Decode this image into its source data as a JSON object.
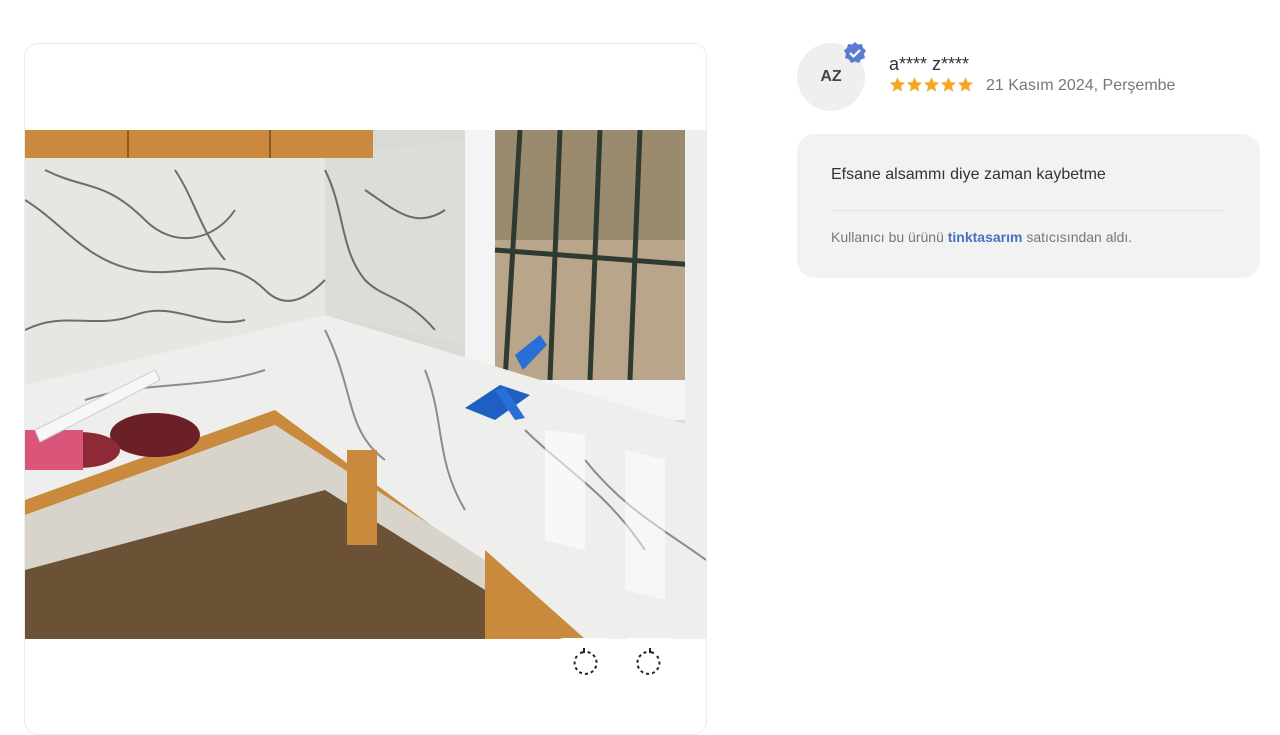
{
  "photo": {
    "alt": "Mermer desenli tezgah ve duvar kaplaması"
  },
  "controls": {
    "rotate_left_icon": "rotate-ccw-icon",
    "rotate_right_icon": "rotate-cw-icon"
  },
  "reviewer": {
    "initials": "AZ",
    "name": "a**** z****",
    "rating": 5,
    "date": "21 Kasım 2024, Perşembe",
    "verified_icon": "verified-badge-icon"
  },
  "review": {
    "text": "Efsane alsammı diye zaman kaybetme",
    "seller_prefix": "Kullanıcı bu ürünü",
    "seller_name": "tinktasarım",
    "seller_suffix": "satıcısından aldı."
  },
  "colors": {
    "star": "#f5a623",
    "verified": "#5b7ccf",
    "link": "#4b6fc4",
    "review_bg": "#f2f2f2"
  }
}
